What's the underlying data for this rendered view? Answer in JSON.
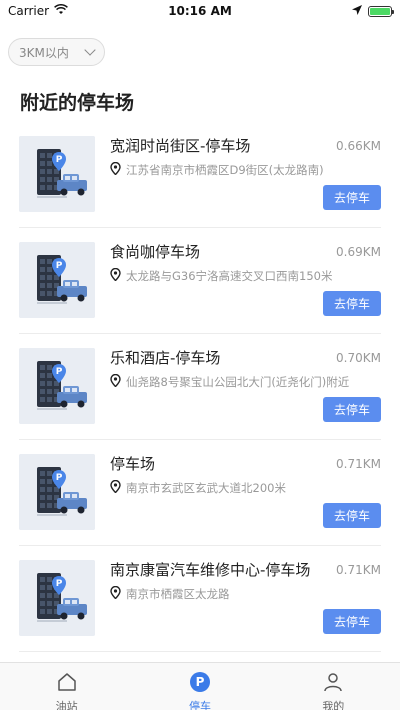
{
  "status_bar": {
    "carrier": "Carrier",
    "time": "10:16 AM",
    "wifi_icon": "wifi-icon",
    "location_icon": "location-arrow-icon",
    "battery_icon": "battery-icon"
  },
  "filter": {
    "label": "3KM以内",
    "icon": "chevron-down-icon"
  },
  "page_title": "附近的停车场",
  "parking_list": [
    {
      "name": "宽润时尚街区-停车场",
      "distance": "0.66KM",
      "address": "江苏省南京市栖霞区D9街区(太龙路南)",
      "button": "去停车"
    },
    {
      "name": "食尚咖停车场",
      "distance": "0.69KM",
      "address": "太龙路与G36宁洛高速交叉口西南150米",
      "button": "去停车"
    },
    {
      "name": "乐和酒店-停车场",
      "distance": "0.70KM",
      "address": "仙尧路8号聚宝山公园北大门(近尧化门)附近",
      "button": "去停车"
    },
    {
      "name": "停车场",
      "distance": "0.71KM",
      "address": "南京市玄武区玄武大道北200米",
      "button": "去停车"
    },
    {
      "name": "南京康富汽车维修中心-停车场",
      "distance": "0.71KM",
      "address": "南京市栖霞区太龙路",
      "button": "去停车"
    }
  ],
  "tabbar": [
    {
      "label": "油站",
      "icon": "home-icon",
      "active": false
    },
    {
      "label": "停车",
      "icon": "parking-icon",
      "active": true
    },
    {
      "label": "我的",
      "icon": "user-icon",
      "active": false
    }
  ],
  "colors": {
    "accent": "#5b8def",
    "tab_active": "#3b7be8",
    "muted_text": "#999999"
  }
}
